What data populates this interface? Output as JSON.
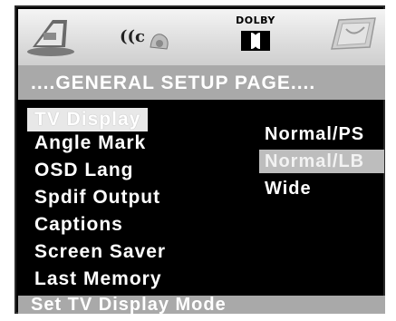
{
  "icon_bar": {
    "icons": [
      "general-setup-icon",
      "audio-setup-icon",
      "dolby-digital-icon",
      "preference-icon"
    ],
    "dolby_label": "DOLBY"
  },
  "page": {
    "title": "....GENERAL SETUP PAGE...."
  },
  "menu": {
    "items": [
      {
        "label": "TV Display",
        "state": "selected"
      },
      {
        "label": "Angle Mark"
      },
      {
        "label": "OSD Lang"
      },
      {
        "label": "Spdif Output"
      },
      {
        "label": "Captions"
      },
      {
        "label": "Screen Saver"
      },
      {
        "label": "Last Memory"
      }
    ]
  },
  "options": {
    "items": [
      {
        "label": "Normal/PS"
      },
      {
        "label": "Normal/LB",
        "state": "highlighted"
      },
      {
        "label": "Wide"
      }
    ]
  },
  "status": {
    "text": "Set TV Display Mode"
  },
  "colors": {
    "background": "#000000",
    "bar_gray": "#a9a9a9",
    "highlight": "#ffffff",
    "text": "#ffffff"
  }
}
